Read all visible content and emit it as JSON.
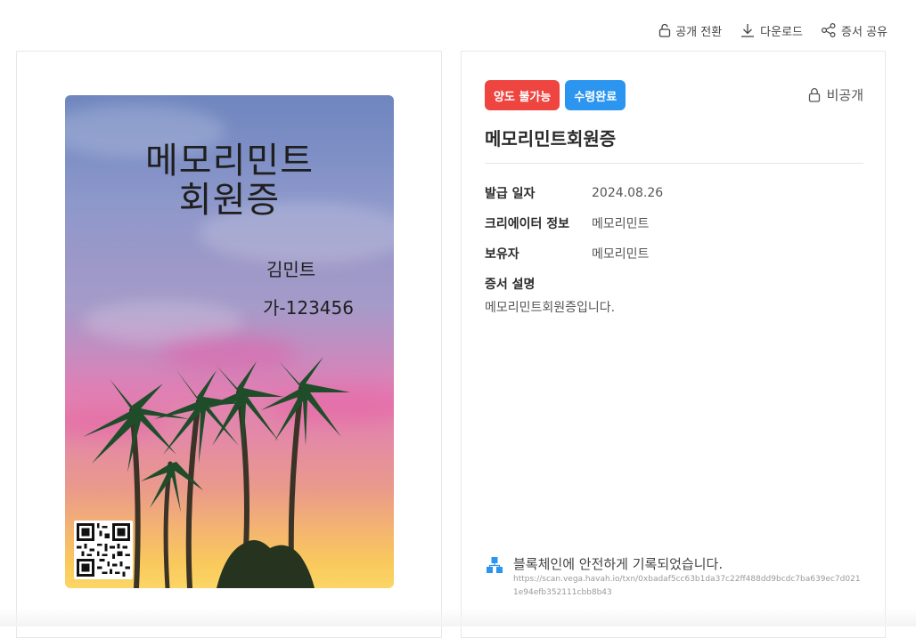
{
  "toolbar": {
    "public_toggle": "공개 전환",
    "download": "다운로드",
    "share": "증서 공유"
  },
  "card": {
    "title_line1": "메모리민트",
    "title_line2": "회원증",
    "holder_name": "김민트",
    "member_code": "가-123456"
  },
  "detail": {
    "badges": {
      "transfer": "양도 불가능",
      "status": "수령완료"
    },
    "visibility": "비공개",
    "title": "메모리민트회원증",
    "fields": [
      {
        "label": "발급 일자",
        "value": "2024.08.26"
      },
      {
        "label": "크리에이터 정보",
        "value": "메모리민트"
      },
      {
        "label": "보유자",
        "value": "메모리민트"
      }
    ],
    "description_label": "증서 설명",
    "description": "메모리민트회원증입니다."
  },
  "blockchain": {
    "message": "블록체인에 안전하게 기록되었습니다.",
    "url": "https://scan.vega.havah.io/txn/0xbadaf5cc63b1da37c22ff488dd9bcdc7ba639ec7d0211e94efb352111cbb8b43"
  },
  "colors": {
    "badge_red": "#ee4540",
    "badge_blue": "#2b95ef",
    "chain_icon": "#2b95ef"
  }
}
